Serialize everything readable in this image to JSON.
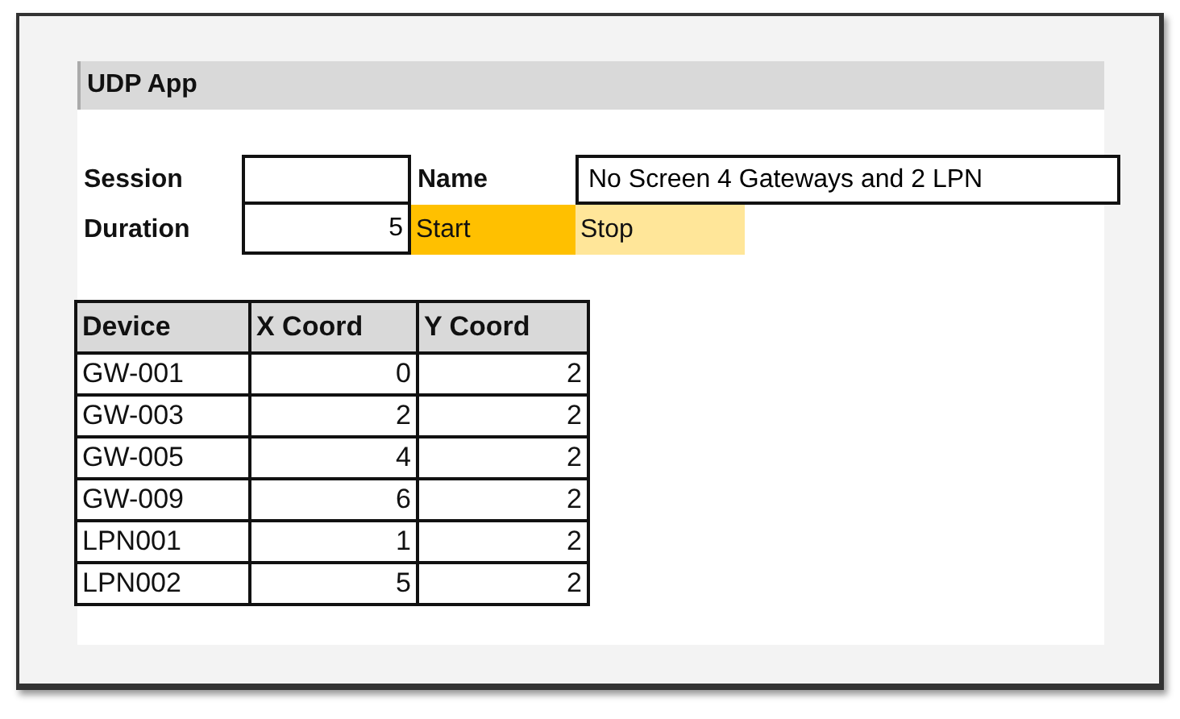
{
  "title": "UDP App",
  "form": {
    "session": {
      "label": "Session"
    },
    "name": {
      "label": "Name",
      "value": "No Screen 4 Gateways and 2 LPN"
    },
    "duration": {
      "label": "Duration",
      "value": "5"
    },
    "buttons": [
      "Start",
      "Stop"
    ]
  },
  "table": {
    "columns": [
      "Device",
      "X Coord",
      "Y Coord"
    ],
    "rows": [
      [
        "GW-001",
        "0",
        "2"
      ],
      [
        "GW-003",
        "2",
        "2"
      ],
      [
        "GW-005",
        "4",
        "2"
      ],
      [
        "GW-009",
        "6",
        "2"
      ],
      [
        "LPN001",
        "1",
        "2"
      ],
      [
        "LPN002",
        "5",
        "2"
      ]
    ]
  }
}
